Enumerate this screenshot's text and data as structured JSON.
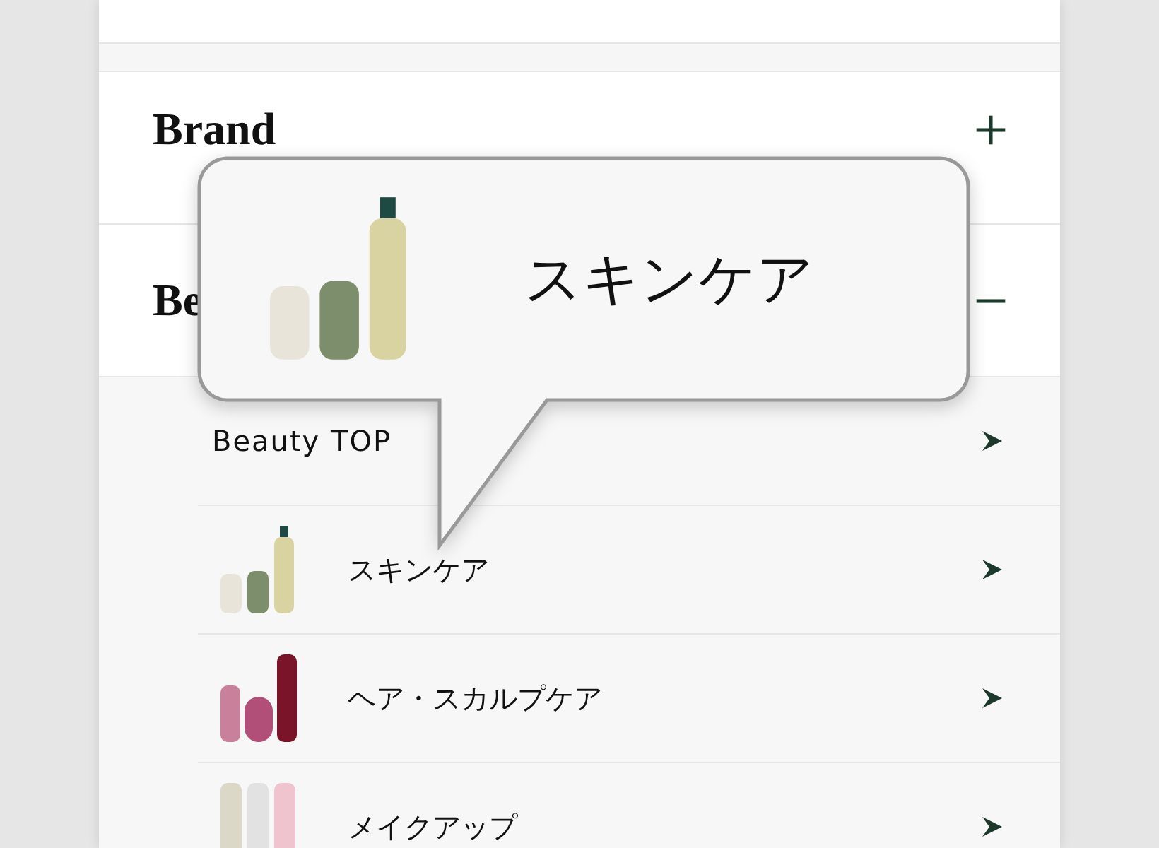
{
  "sections": [
    {
      "title": "Brand",
      "expanded": false
    },
    {
      "title": "Be",
      "expanded": true
    }
  ],
  "submenu": [
    {
      "label": "Beauty TOP",
      "kind": "top"
    },
    {
      "label": "スキンケア",
      "kind": "skincare"
    },
    {
      "label": "ヘア・スカルプケア",
      "kind": "hair"
    },
    {
      "label": "メイクアップ",
      "kind": "makeup"
    }
  ],
  "callout": {
    "label": "スキンケア",
    "kind": "skincare"
  }
}
